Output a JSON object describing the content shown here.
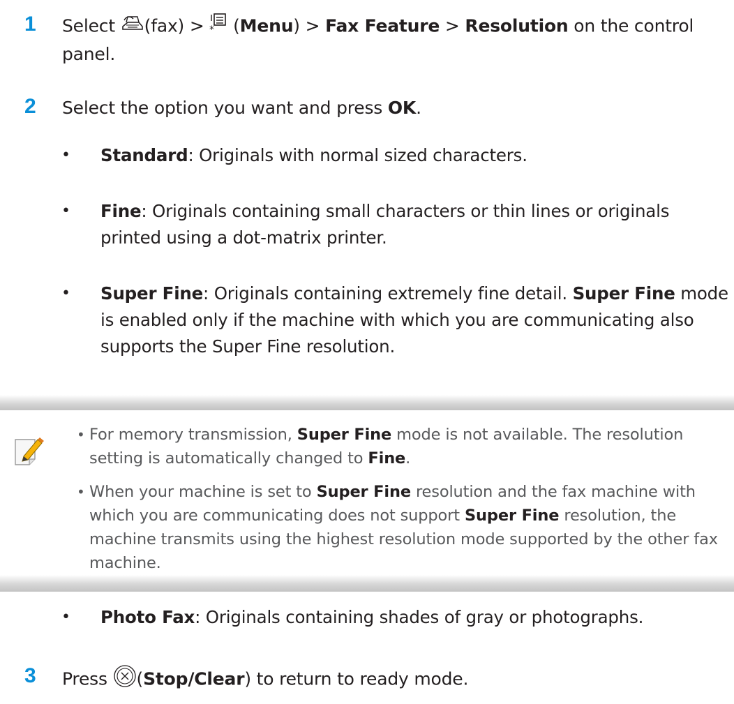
{
  "step1": {
    "number": "1",
    "select": "Select ",
    "fax": "(fax) > ",
    "paren_open": " (",
    "menu": "Menu",
    "paren_close": ") > ",
    "fax_feature": "Fax Feature",
    "sep": " > ",
    "resolution": "Resolution",
    "rest": " on the control panel."
  },
  "step2": {
    "number": "2",
    "pre": "Select the option you want and press ",
    "ok": "OK",
    "post": ".",
    "options": [
      {
        "label": "Standard",
        "desc": ": Originals with normal sized characters."
      },
      {
        "label": "Fine",
        "desc": ": Originals containing small characters or thin lines or originals printed using a dot-matrix printer."
      },
      {
        "label": "Super Fine",
        "desc": ": Originals containing extremely fine detail. ",
        "label2": "Super Fine",
        "desc2": " mode is enabled only if the machine with which you are communicating also supports the Super Fine resolution."
      }
    ],
    "photo": {
      "label": "Photo Fax",
      "desc": ": Originals containing shades of gray or photographs."
    }
  },
  "note": {
    "item1": {
      "a": "For memory transmission, ",
      "b": "Super Fine",
      "c": " mode is not available. The resolution setting is automatically changed to ",
      "d": "Fine",
      "e": "."
    },
    "item2": {
      "a": "When your machine is set to ",
      "b": "Super Fine",
      "c": " resolution and the fax machine with which you are communicating does not support ",
      "d": "Super Fine",
      "e": " resolution, the machine transmits using the highest resolution mode supported by the other fax machine."
    }
  },
  "step3": {
    "number": "3",
    "press": "Press ",
    "paren_open": "(",
    "stop_clear": "Stop/Clear",
    "rest": ") to return to ready mode."
  },
  "bullet_char": "•",
  "colors": {
    "step_number": "#0a8fd8",
    "note_text": "#58595b"
  },
  "icons": [
    "fax-icon",
    "menu-icon",
    "note-pencil-icon",
    "stop-clear-icon"
  ]
}
